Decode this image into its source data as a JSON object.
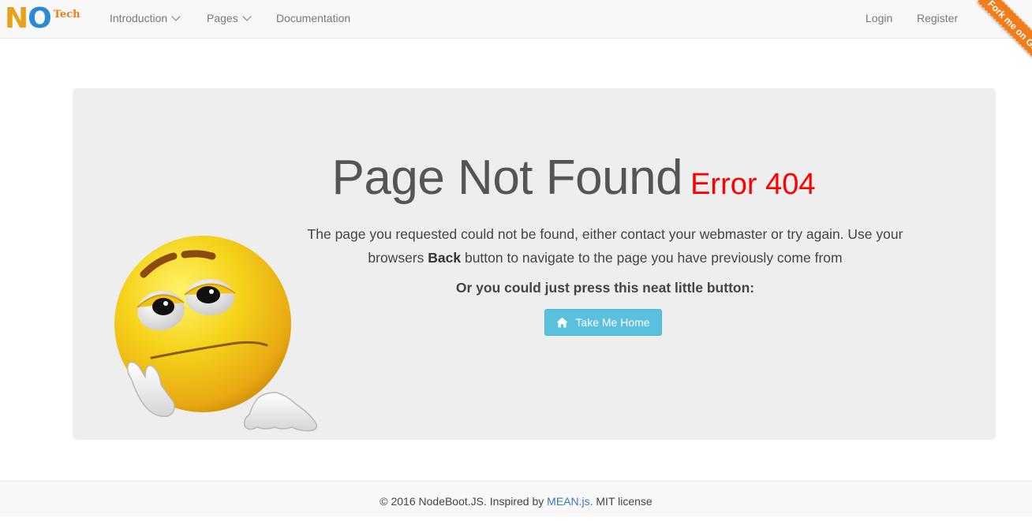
{
  "brand": {
    "n": "N",
    "o": "O",
    "tech": "Tech"
  },
  "nav": {
    "introduction": "Introduction",
    "pages": "Pages",
    "documentation": "Documentation",
    "login": "Login",
    "register": "Register"
  },
  "ribbon": "Fork me on GitHub",
  "main": {
    "title": "Page Not Found",
    "error": "Error 404",
    "paragraph_before": "The page you requested could not be found, either contact your webmaster or try again. Use your browsers ",
    "paragraph_bold": "Back",
    "paragraph_after": " button to navigate to the page you have previously come from",
    "subtitle": "Or you could just press this neat little button:",
    "button_label": "Take Me Home"
  },
  "footer": {
    "prefix": "© 2016 NodeBoot.JS. Inspired by ",
    "link": "MEAN.js",
    "suffix": ". MIT license"
  },
  "colors": {
    "accent": "#5bc0de",
    "error": "#ff0000",
    "ribbon": "#f07d1a"
  },
  "icons": {
    "button": "home-icon",
    "nav_dropdown": "chevron-down-icon"
  }
}
